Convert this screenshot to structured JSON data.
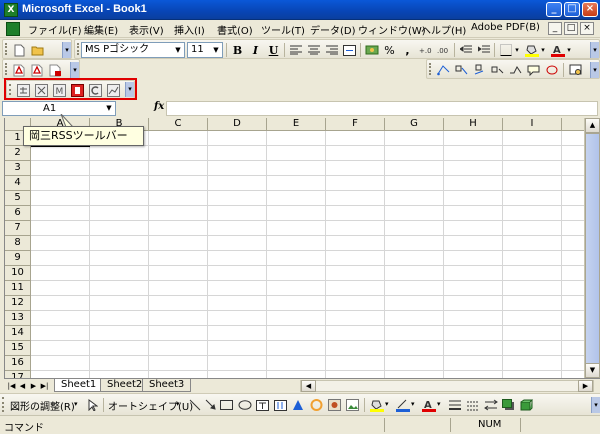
{
  "window": {
    "title": "Microsoft Excel - Book1",
    "app_icon": "excel-icon",
    "controls": [
      "_",
      "□",
      "×"
    ]
  },
  "menubar": {
    "items": [
      "ファイル(F)",
      "編集(E)",
      "表示(V)",
      "挿入(I)",
      "書式(O)",
      "ツール(T)",
      "データ(D)",
      "ウィンドウ(W)",
      "ヘルプ(H)",
      "Adobe PDF(B)"
    ],
    "mdi_controls": [
      "_",
      "□",
      "×"
    ]
  },
  "formatting_toolbar": {
    "font_name": "MS Pゴシック",
    "font_size": "11",
    "bold": "B",
    "italic": "I",
    "underline": "U",
    "percent": "%",
    "comma": ","
  },
  "rss_toolbar": {
    "tooltip": "岡三RSSツールバー"
  },
  "formula_bar": {
    "name_box": "A1",
    "fx_label": "fx",
    "formula": ""
  },
  "grid": {
    "columns": [
      "A",
      "B",
      "C",
      "D",
      "E",
      "F",
      "G",
      "H",
      "I"
    ],
    "rows": [
      "1",
      "2",
      "3",
      "4",
      "5",
      "6",
      "7",
      "8",
      "9",
      "10",
      "11",
      "12",
      "13",
      "14",
      "15",
      "16",
      "17"
    ]
  },
  "sheet_tabs": [
    "Sheet1",
    "Sheet2",
    "Sheet3"
  ],
  "drawing_toolbar": {
    "draw_menu": "図形の調整(R)",
    "autoshapes_menu": "オートシェイプ(U)"
  },
  "status_bar": {
    "mode": "コマンド",
    "num_lock": "NUM"
  },
  "colors": {
    "highlight": "#e00000",
    "title_bar": "#0a58d8",
    "tooltip_bg": "#ffffe1"
  }
}
